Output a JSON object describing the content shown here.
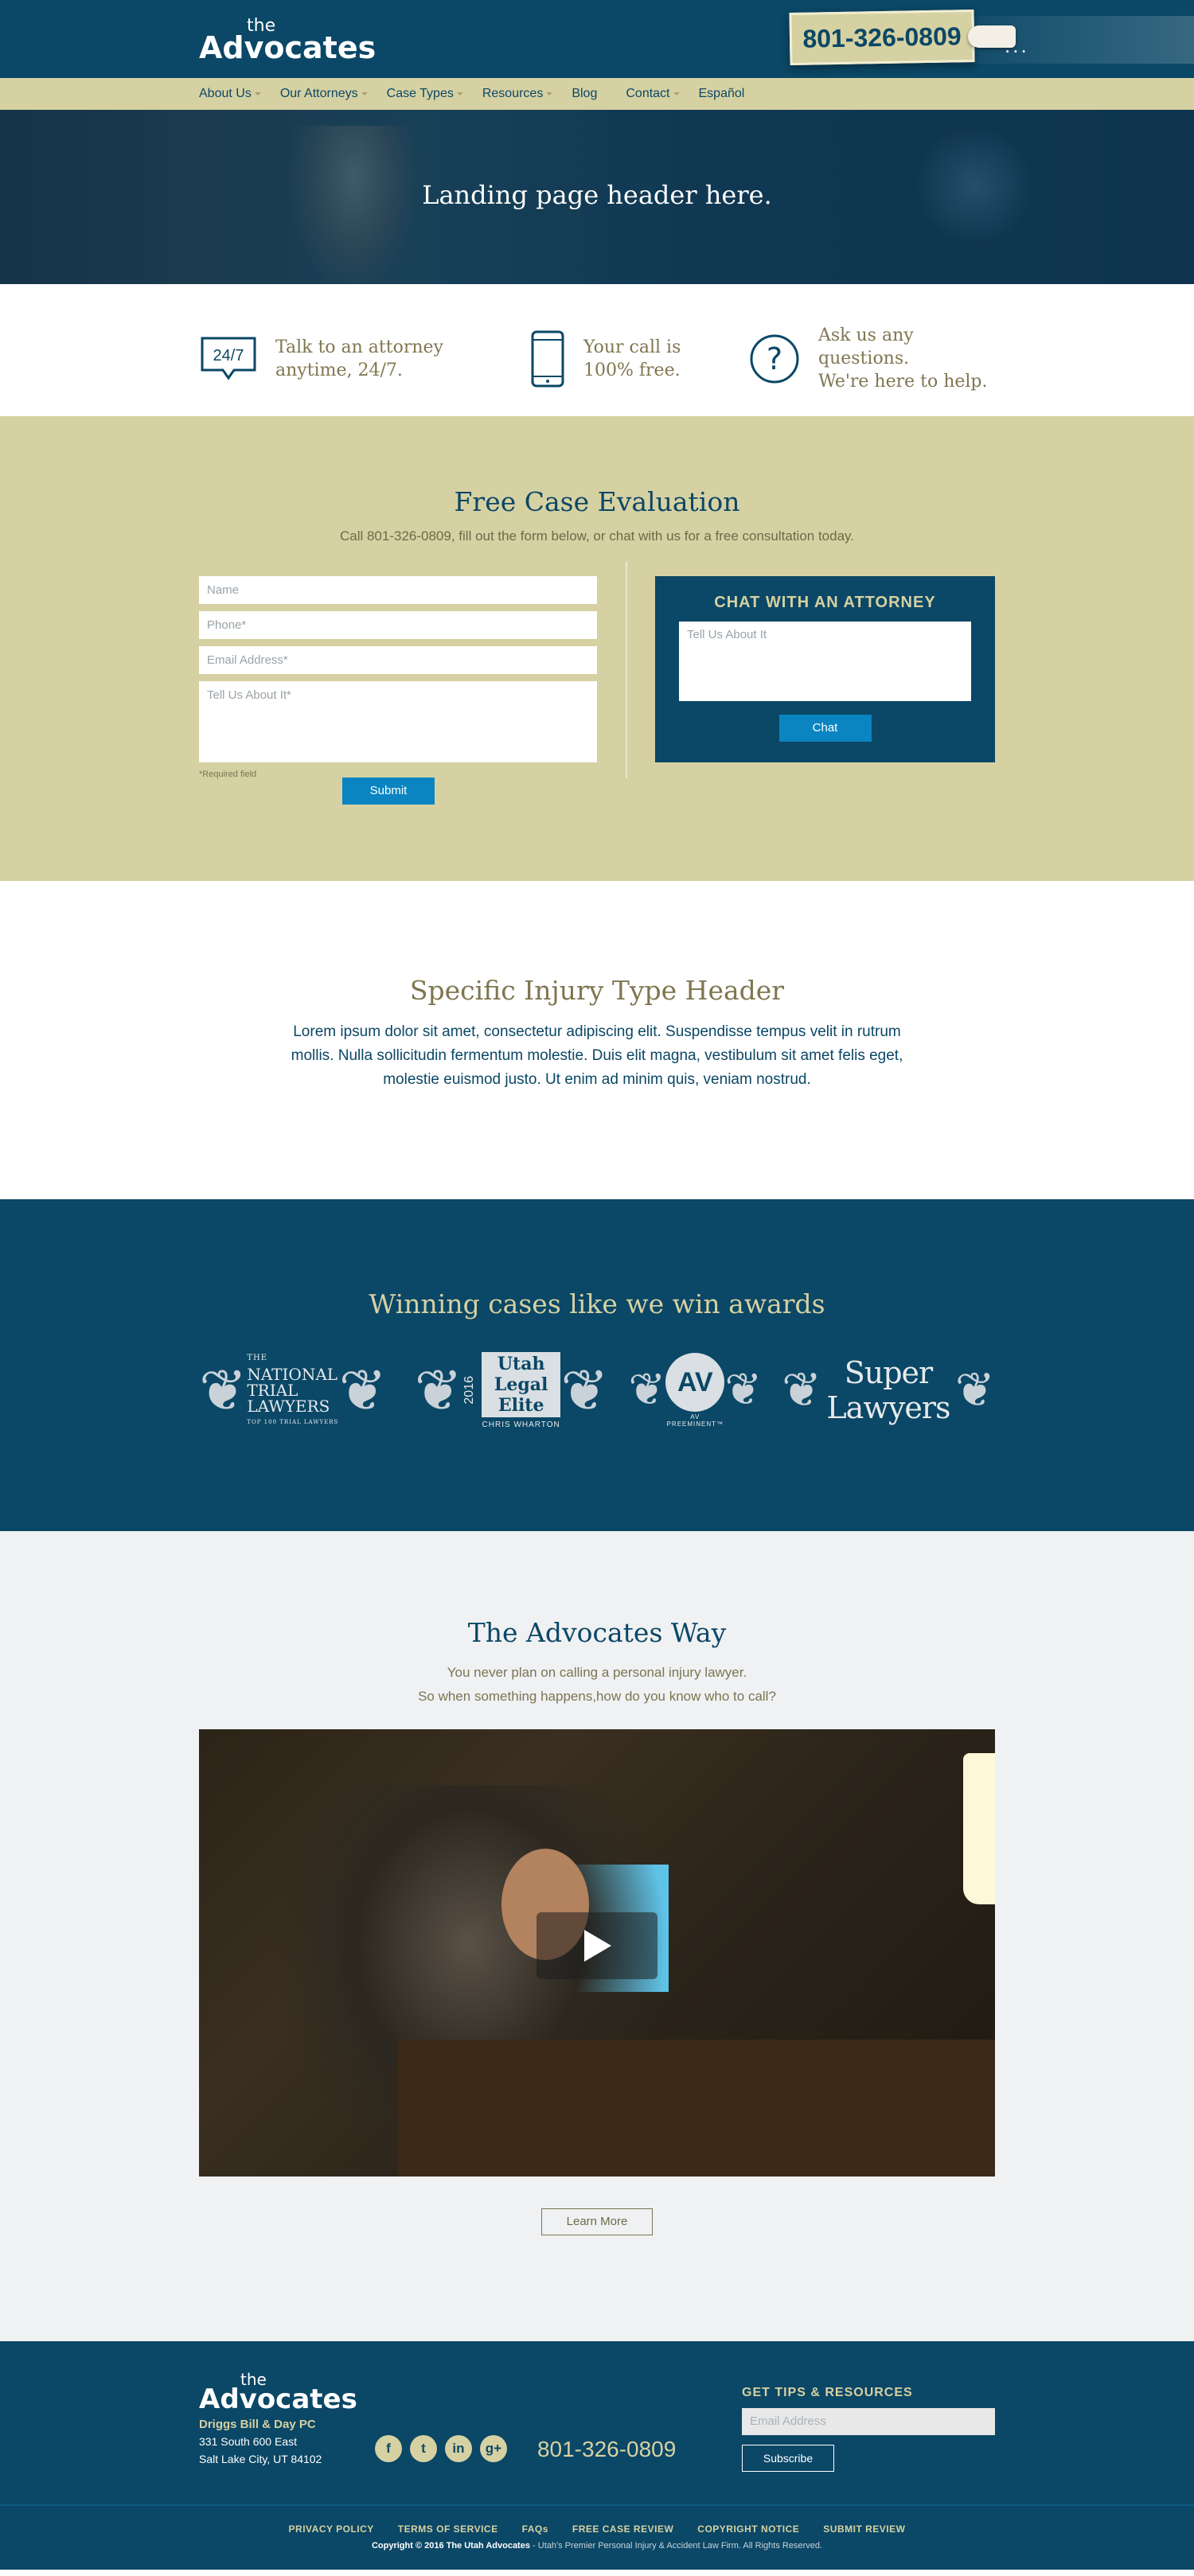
{
  "brand": {
    "the": "the",
    "name": "Advocates"
  },
  "header": {
    "phone": "801-326-0809",
    "dots": "..."
  },
  "nav": [
    {
      "label": "About Us",
      "dropdown": true
    },
    {
      "label": "Our Attorneys",
      "dropdown": true
    },
    {
      "label": "Case Types",
      "dropdown": true
    },
    {
      "label": "Resources",
      "dropdown": true
    },
    {
      "label": "Blog",
      "dropdown": false
    },
    {
      "label": "Contact",
      "dropdown": true
    },
    {
      "label": "Español",
      "dropdown": false
    }
  ],
  "hero": {
    "title": "Landing page header here."
  },
  "features": [
    {
      "icon": "24-7-chat-icon",
      "icon_text": "24/7",
      "line1": "Talk to an attorney",
      "line2": "anytime, 24/7."
    },
    {
      "icon": "phone-icon",
      "line1": "Your call is",
      "line2": "100% free."
    },
    {
      "icon": "question-icon",
      "line1": "Ask us any questions.",
      "line2": "We're here to help."
    }
  ],
  "case": {
    "title": "Free Case Evaluation",
    "subtitle": "Call 801-326-0809, fill out the form below, or chat with us for a free consultation today.",
    "fields": {
      "name": "Name",
      "phone": "Phone*",
      "email": "Email Address*",
      "about": "Tell Us About It*"
    },
    "required_note": "*Required field",
    "submit": "Submit",
    "chat": {
      "title": "CHAT WITH AN ATTORNEY",
      "placeholder": "Tell Us About It",
      "button": "Chat"
    }
  },
  "injury": {
    "title": "Specific Injury Type Header",
    "body": "Lorem ipsum dolor sit amet, consectetur adipiscing elit. Suspendisse tempus velit in rutrum mollis. Nulla sollicitudin fermentum molestie. Duis elit magna, vestibulum sit amet felis eget, molestie euismod justo. Ut enim ad minim quis, veniam nostrud."
  },
  "awards": {
    "title": "Winning cases like we win awards",
    "items": [
      {
        "line1": "THE",
        "line2": "NATIONAL",
        "line3": "TRIAL LAWYERS",
        "line4": "TOP 100 TRIAL LAWYERS"
      },
      {
        "year": "2016",
        "line1": "Utah",
        "line2": "Legal Elite",
        "line3": "CHRIS WHARTON"
      },
      {
        "mark": "AV",
        "line1": "AV PREEMINENT™"
      },
      {
        "line1": "Super Lawyers"
      }
    ]
  },
  "way": {
    "title": "The Advocates Way",
    "line1": "You never plan on calling a personal injury lawyer.",
    "line2": "So when something happens,how do you know who to call?",
    "button": "Learn More"
  },
  "footer": {
    "firm": "Driggs Bill & Day PC",
    "addr1": "331 South 600 East",
    "addr2": "Salt Lake City, UT 84102",
    "social": [
      "f",
      "t",
      "in",
      "g+"
    ],
    "phone": "801-326-0809",
    "tips_title": "GET TIPS & RESOURCES",
    "email_placeholder": "Email Address",
    "subscribe": "Subscribe",
    "links": [
      "PRIVACY POLICY",
      "TERMS OF SERVICE",
      "FAQs",
      "FREE CASE REVIEW",
      "COPYRIGHT NOTICE",
      "SUBMIT REVIEW"
    ],
    "copyright_bold": "Copyright © 2016 The Utah Advocates",
    "copyright_rest": " - Utah's Premier Personal Injury & Accident Law Firm. All Rights Reserved."
  },
  "colors": {
    "navy": "#0b4766",
    "khaki": "#d6d1a2",
    "blue": "#0a85c2",
    "olive": "#7f7650"
  }
}
